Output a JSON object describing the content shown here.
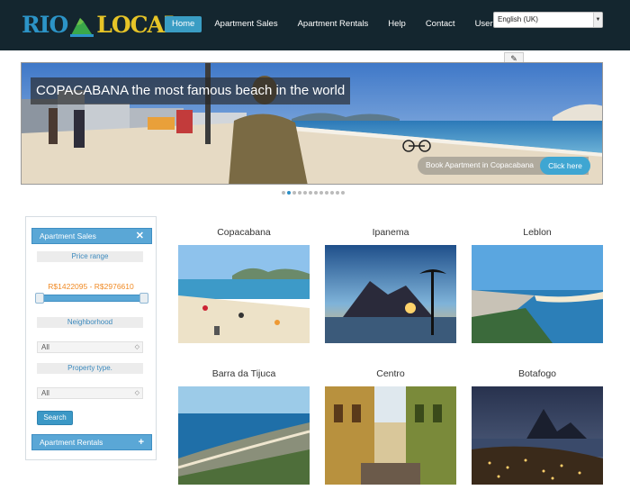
{
  "header": {
    "logo_left": "RIO",
    "logo_right": "LOCAL",
    "nav": [
      {
        "label": "Home",
        "active": true
      },
      {
        "label": "Apartment Sales",
        "active": false
      },
      {
        "label": "Apartment Rentals",
        "active": false
      },
      {
        "label": "Help",
        "active": false
      },
      {
        "label": "Contact",
        "active": false
      },
      {
        "label": "User",
        "active": false
      }
    ],
    "language": "English (UK)"
  },
  "hero": {
    "title": "COPACABANA the most famous beach in the world",
    "book_text": "Book Apartment in Copacabana",
    "cta": "Click here",
    "slide_count": 12,
    "active_slide": 1
  },
  "sidebar": {
    "sales_header": "Apartment Sales",
    "sales_toggle": "✕",
    "price_label": "Price range",
    "price_value": "R$1422095 - R$2976610",
    "neighborhood_label": "Neighborhood",
    "neighborhood_value": "All",
    "property_label": "Property type.",
    "property_value": "All",
    "search_label": "Search",
    "rentals_header": "Apartment Rentals",
    "rentals_toggle": "+"
  },
  "neighborhoods": [
    {
      "name": "Copacabana"
    },
    {
      "name": "Ipanema"
    },
    {
      "name": "Leblon"
    },
    {
      "name": "Barra da Tijuca"
    },
    {
      "name": "Centro"
    },
    {
      "name": "Botafogo"
    }
  ],
  "colors": {
    "header_bg": "#14262f",
    "accent": "#3a9dc4",
    "price": "#f08a24",
    "logo_blue": "#2c94c7",
    "logo_yellow": "#e6c427"
  }
}
